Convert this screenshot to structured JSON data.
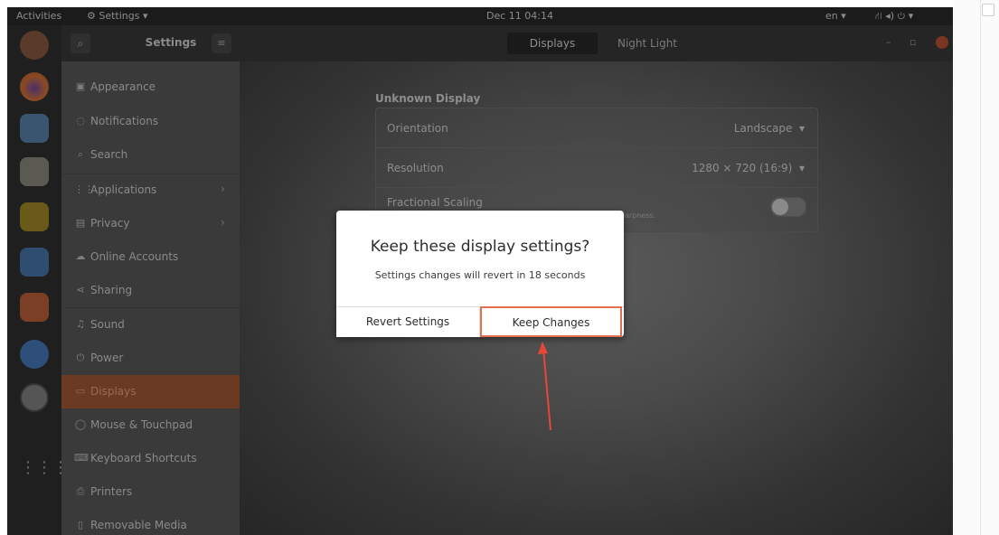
{
  "topbar": {
    "activities": "Activities",
    "app_menu": "Settings ▾",
    "clock": "Dec 11 04:14",
    "lang": "en ▾",
    "status_icons": "⛙ ◂) ⏻ ▾"
  },
  "header": {
    "title": "Settings",
    "tabs": [
      {
        "label": "Displays"
      },
      {
        "label": "Night Light"
      }
    ],
    "minimize": "–",
    "maximize": "▫"
  },
  "sidebar": {
    "items": [
      {
        "label": "Appearance",
        "icon": "appearance-icon",
        "glyph": "▣"
      },
      {
        "label": "Notifications",
        "icon": "notifications-icon",
        "glyph": "◌"
      },
      {
        "label": "Search",
        "icon": "search-icon",
        "glyph": "⌕"
      },
      {
        "label": "Applications",
        "icon": "applications-icon",
        "glyph": "⋮⋮",
        "chevron": "›"
      },
      {
        "label": "Privacy",
        "icon": "privacy-icon",
        "glyph": "▤",
        "chevron": "›"
      },
      {
        "label": "Online Accounts",
        "icon": "cloud-icon",
        "glyph": "☁"
      },
      {
        "label": "Sharing",
        "icon": "share-icon",
        "glyph": "⋖"
      },
      {
        "label": "Sound",
        "icon": "music-note-icon",
        "glyph": "♫"
      },
      {
        "label": "Power",
        "icon": "power-icon",
        "glyph": "⏻"
      },
      {
        "label": "Displays",
        "icon": "display-icon",
        "glyph": "▭"
      },
      {
        "label": "Mouse & Touchpad",
        "icon": "mouse-icon",
        "glyph": "◯"
      },
      {
        "label": "Keyboard Shortcuts",
        "icon": "keyboard-icon",
        "glyph": "⌨"
      },
      {
        "label": "Printers",
        "icon": "printer-icon",
        "glyph": "⎙"
      },
      {
        "label": "Removable Media",
        "icon": "removable-media-icon",
        "glyph": "▯"
      }
    ]
  },
  "main": {
    "display_name": "Unknown Display",
    "rows": [
      {
        "label": "Orientation",
        "value": "Landscape"
      },
      {
        "label": "Resolution",
        "value": "1280 × 720 (16:9)"
      },
      {
        "label": "Fractional Scaling",
        "sub": "harpness."
      }
    ],
    "dropdown_glyph": "▾"
  },
  "dialog": {
    "heading": "Keep these display settings?",
    "message": "Settings changes will revert in 18 seconds",
    "revert_label": "Revert Settings",
    "keep_label": "Keep Changes"
  },
  "colors": {
    "accent": "#e0704f",
    "sidebar_active": "#6a3a23",
    "arrow": "#e8463a"
  }
}
